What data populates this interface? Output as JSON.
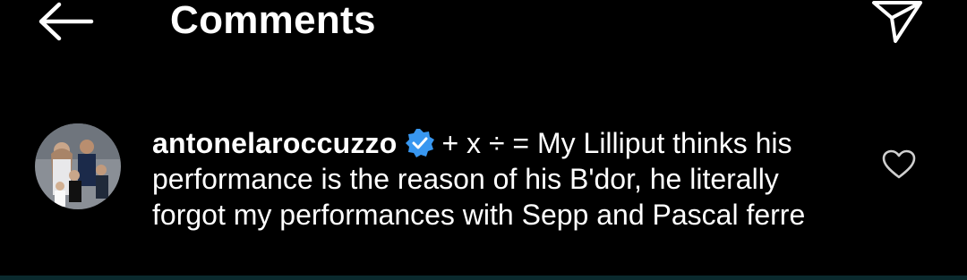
{
  "header": {
    "title": "Comments",
    "back_icon": "arrow-left-icon",
    "send_icon": "send-icon"
  },
  "comment": {
    "username": "antonelaroccuzzo",
    "verified_icon": "verified-badge-icon",
    "body": "+ x ÷ = My Lilliput thinks his performance is the reason of his B'dor, he literally forgot my performances with Sepp and Pascal ferre",
    "like_icon": "heart-outline-icon"
  },
  "colors": {
    "background": "#000000",
    "text": "#ffffff",
    "verified": "#3897f0"
  }
}
